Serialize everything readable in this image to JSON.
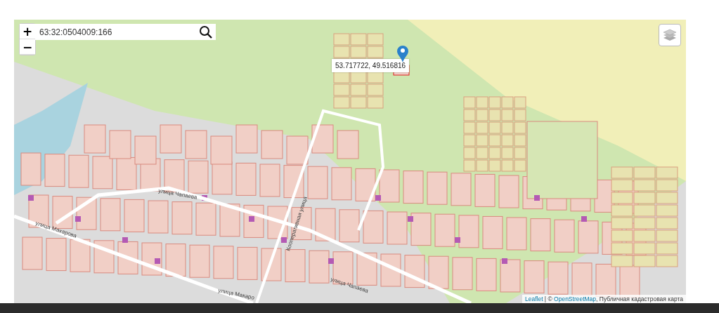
{
  "search": {
    "value": "63:32:0504009:166"
  },
  "zoom_controls": [
    {
      "label": "+"
    },
    {
      "label": "−"
    }
  ],
  "marker": {
    "popup": "53.717722, 49.516816"
  },
  "street_labels": [
    {
      "text": "улица Макарова"
    },
    {
      "text": "улица Чапаева"
    },
    {
      "text": "Кооперативная улица"
    },
    {
      "text": "улица Чапаева"
    },
    {
      "text": "улица Макаро"
    }
  ],
  "attribution": [
    {
      "kind": "link",
      "text": "Leaflet"
    },
    {
      "kind": "plain",
      "text": " | © "
    },
    {
      "kind": "link",
      "text": "OpenStreetMap"
    },
    {
      "kind": "plain",
      "text": ", Публичная кадастровая карта"
    }
  ]
}
